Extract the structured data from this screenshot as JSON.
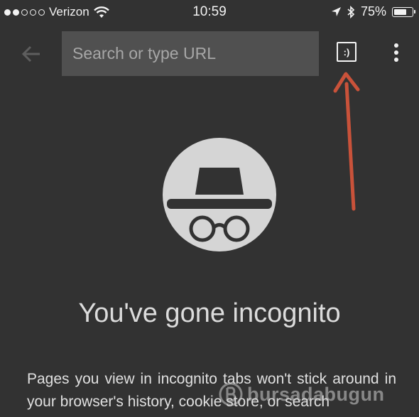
{
  "status_bar": {
    "carrier": "Verizon",
    "signal_bars": 2,
    "time": "10:59",
    "battery_percent": "75%",
    "battery_level": 0.75
  },
  "toolbar": {
    "search_placeholder": "Search or type URL",
    "tabs_button_label": ":)"
  },
  "incognito": {
    "heading": "You've gone incognito",
    "body": "Pages you view in incognito tabs won't stick around in your browser's history, cookie store, or search"
  },
  "watermark": {
    "text": "bursadabugun"
  },
  "colors": {
    "background": "#323232",
    "omnibox": "#505050",
    "arrow": "#c9523a",
    "avatar": "#d5d5d5"
  }
}
